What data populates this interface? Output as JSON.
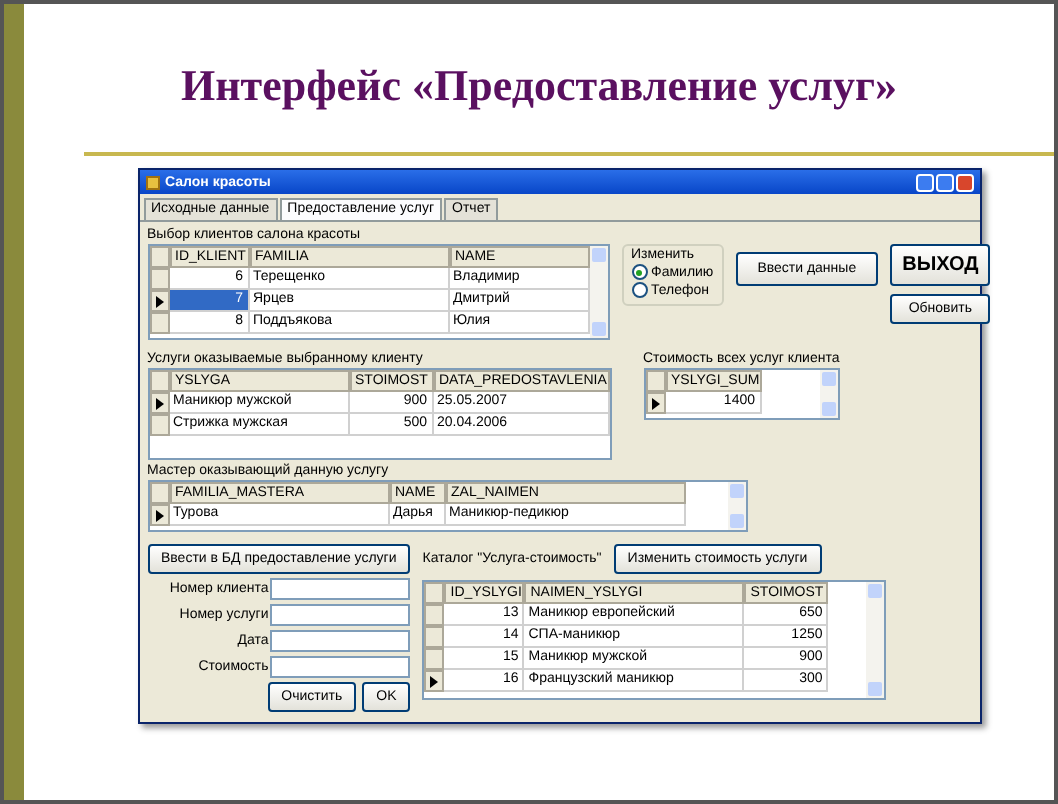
{
  "slide_title": "Интерфейс «Предоставление услуг»",
  "window": {
    "title": "Салон красоты"
  },
  "tabs": [
    {
      "label": "Исходные данные",
      "selected": false
    },
    {
      "label": "Предоставление услуг",
      "selected": true
    },
    {
      "label": "Отчет",
      "selected": false
    }
  ],
  "clients": {
    "label": "Выбор клиентов салона красоты",
    "columns": [
      {
        "name": "ID_KLIENT",
        "kind": "number"
      },
      {
        "name": "FAMILIA",
        "kind": "text"
      },
      {
        "name": "NAME",
        "kind": "text"
      }
    ],
    "rows": [
      {
        "cells": [
          "6",
          "Терещенко",
          "Владимир"
        ],
        "selected": false,
        "focused": false
      },
      {
        "cells": [
          "7",
          "Ярцев",
          "Дмитрий"
        ],
        "selected": true,
        "focused": true
      },
      {
        "cells": [
          "8",
          "Поддъякова",
          "Юлия"
        ],
        "selected": false,
        "focused": false
      }
    ]
  },
  "change": {
    "label": "Изменить",
    "options": [
      {
        "label": "Фамилию",
        "selected": true
      },
      {
        "label": "Телефон",
        "selected": false
      }
    ]
  },
  "enter_button": "Ввести данные",
  "exit_button": "ВЫХОД",
  "refresh_button": "Обновить",
  "services": {
    "label": "Услуги оказываемые выбранному клиенту",
    "columns": [
      {
        "name": "YSLYGA",
        "kind": "text"
      },
      {
        "name": "STOIMOST",
        "kind": "number"
      },
      {
        "name": "DATA_PREDOSTAVLENIA",
        "kind": "text"
      }
    ],
    "rows": [
      {
        "cells": [
          "Маникюр мужской",
          "900",
          "25.05.2007"
        ],
        "selected": true
      },
      {
        "cells": [
          "Стрижка мужская",
          "500",
          "20.04.2006"
        ],
        "selected": false
      }
    ]
  },
  "total": {
    "label": "Стоимость всех услуг клиента",
    "columns": [
      {
        "name": "YSLYGI_SUM",
        "kind": "number"
      }
    ],
    "rows": [
      {
        "cells": [
          "1400"
        ],
        "selected": true
      }
    ]
  },
  "master": {
    "label": "Мастер оказывающий данную услугу",
    "columns": [
      {
        "name": "FAMILIA_MASTERA",
        "kind": "text"
      },
      {
        "name": "NAME",
        "kind": "text"
      },
      {
        "name": "ZAL_NAIMEN",
        "kind": "text"
      }
    ],
    "rows": [
      {
        "cells": [
          "Турова",
          "Дарья",
          "Маникюр-педикюр"
        ],
        "selected": true
      }
    ]
  },
  "entry": {
    "button": "Ввести в БД предоставление услуги",
    "fields": [
      {
        "label": "Номер клиента"
      },
      {
        "label": "Номер услуги"
      },
      {
        "label": "Дата"
      },
      {
        "label": "Стоимость"
      }
    ],
    "clear_button": "Очистить",
    "ok_button": "OK"
  },
  "catalog": {
    "label": "Каталог \"Услуга-стоимость\"",
    "button": "Изменить стоимость услуги",
    "columns": [
      {
        "name": "ID_YSLYGI",
        "kind": "number"
      },
      {
        "name": "NAIMEN_YSLYGI",
        "kind": "text"
      },
      {
        "name": "STOIMOST",
        "kind": "number"
      }
    ],
    "rows": [
      {
        "cells": [
          "13",
          "Маникюр европейский",
          "650"
        ],
        "selected": false
      },
      {
        "cells": [
          "14",
          "СПА-маникюр",
          "1250"
        ],
        "selected": false
      },
      {
        "cells": [
          "15",
          "Маникюр мужской",
          "900"
        ],
        "selected": false
      },
      {
        "cells": [
          "16",
          "Французский маникюр",
          "300"
        ],
        "selected": true
      }
    ]
  }
}
